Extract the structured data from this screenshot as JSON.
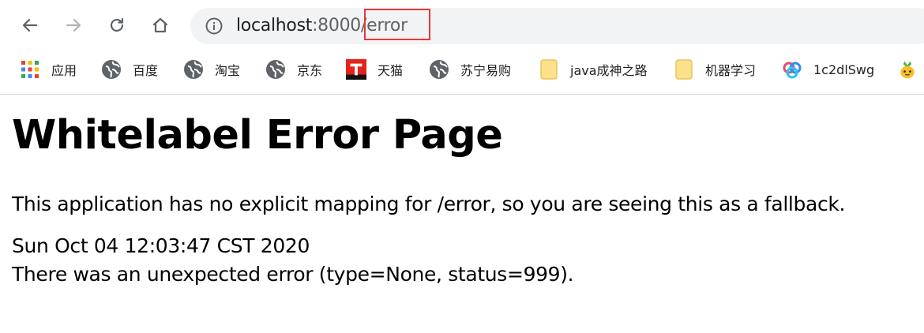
{
  "browser": {
    "url": {
      "host": "localhost",
      "port": ":8000",
      "path": "/error"
    },
    "highlight_color": "#e53935"
  },
  "bookmarks": [
    {
      "label": "应用",
      "icon": "apps-grid-icon"
    },
    {
      "label": "百度",
      "icon": "globe-icon"
    },
    {
      "label": "淘宝",
      "icon": "globe-icon"
    },
    {
      "label": "京东",
      "icon": "globe-icon"
    },
    {
      "label": "天猫",
      "icon": "tmall-icon"
    },
    {
      "label": "苏宁易购",
      "icon": "globe-icon"
    },
    {
      "label": "java成神之路",
      "icon": "folder-icon"
    },
    {
      "label": "机器学习",
      "icon": "folder-icon"
    },
    {
      "label": "1c2dlSwg",
      "icon": "baidu-pan-icon"
    }
  ],
  "page": {
    "title": "Whitelabel Error Page",
    "description": "This application has no explicit mapping for /error, so you are seeing this as a fallback.",
    "timestamp": "Sun Oct 04 12:03:47 CST 2020",
    "error_message": "There was an unexpected error (type=None, status=999)."
  }
}
